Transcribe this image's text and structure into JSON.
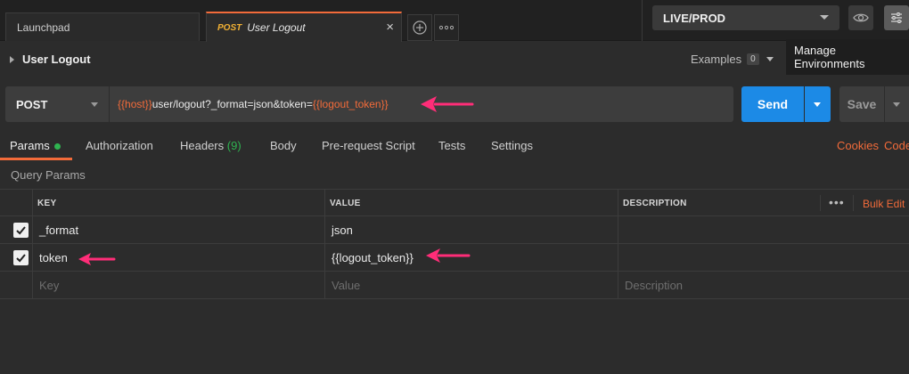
{
  "tabs": [
    {
      "label": "Launchpad"
    },
    {
      "method": "POST",
      "label": "User Logout"
    }
  ],
  "environment": {
    "selected": "LIVE/PROD"
  },
  "tooltip": "Manage Environments",
  "request": {
    "name": "User Logout",
    "examples_label": "Examples",
    "examples_count": "0",
    "method": "POST",
    "url": {
      "var_host": "{{host}}",
      "path": "user/logout?_format=json&token=",
      "var_token": "{{logout_token}}"
    },
    "send_label": "Send",
    "save_label": "Save"
  },
  "subtabs": {
    "params": "Params",
    "authorization": "Authorization",
    "headers": "Headers",
    "headers_count": "(9)",
    "body": "Body",
    "prerequest": "Pre-request Script",
    "tests": "Tests",
    "settings": "Settings",
    "cookies": "Cookies",
    "code": "Code"
  },
  "query_params": {
    "section_label": "Query Params",
    "columns": {
      "key": "KEY",
      "value": "VALUE",
      "description": "DESCRIPTION"
    },
    "bulk_edit": "Bulk Edit",
    "rows": [
      {
        "checked": true,
        "key": "_format",
        "value": "json",
        "description": ""
      },
      {
        "checked": true,
        "key": "token",
        "value": "{{logout_token}}",
        "description": ""
      }
    ],
    "placeholders": {
      "key": "Key",
      "value": "Value",
      "description": "Description"
    }
  },
  "colors": {
    "accent": "#f26b3a",
    "send": "#1c8ae6",
    "annotation_arrow": "#ff2d78",
    "status_green": "#2fb450"
  }
}
